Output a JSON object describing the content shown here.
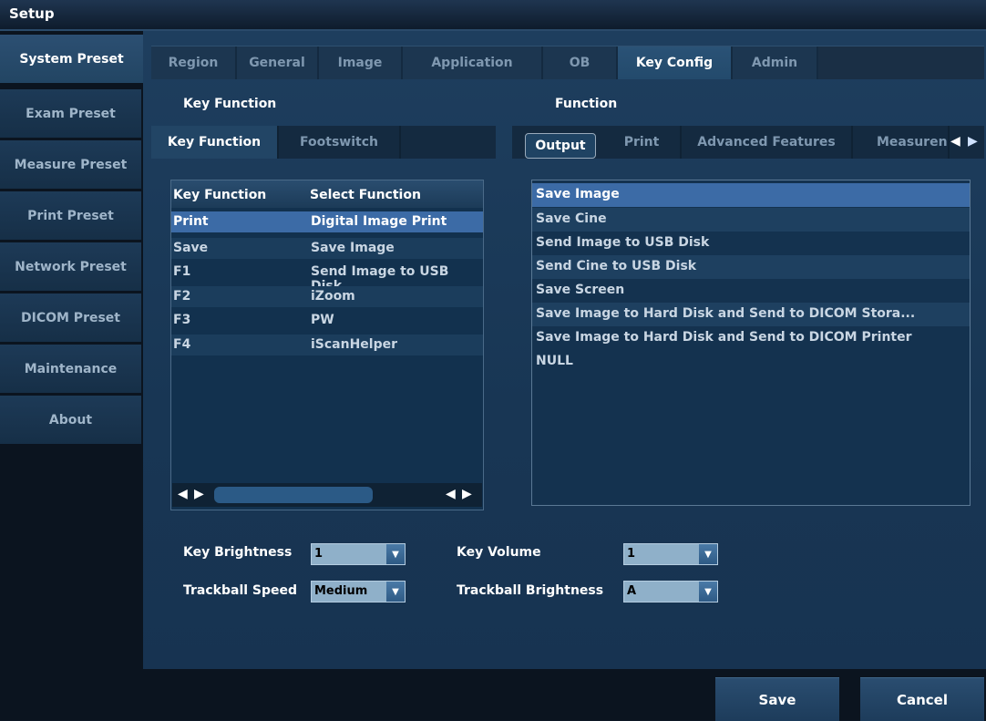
{
  "window": {
    "title": "Setup"
  },
  "sidebar": {
    "items": [
      {
        "label": "System Preset"
      },
      {
        "label": "Exam Preset"
      },
      {
        "label": "Measure Preset"
      },
      {
        "label": "Print Preset"
      },
      {
        "label": "Network Preset"
      },
      {
        "label": "DICOM Preset"
      },
      {
        "label": "Maintenance"
      },
      {
        "label": "About"
      }
    ]
  },
  "tabs": [
    {
      "label": "Region"
    },
    {
      "label": "General"
    },
    {
      "label": "Image"
    },
    {
      "label": "Application"
    },
    {
      "label": "OB"
    },
    {
      "label": "Key Config"
    },
    {
      "label": "Admin"
    }
  ],
  "key_function_section": {
    "title": "Key Function",
    "subtabs": [
      {
        "label": "Key Function"
      },
      {
        "label": "Footswitch"
      }
    ],
    "table": {
      "headers": [
        "Key Function",
        "Select Function"
      ],
      "rows": [
        {
          "key": "Print",
          "func": "Digital Image Print"
        },
        {
          "key": "Save",
          "func": "Save Image"
        },
        {
          "key": "F1",
          "func": "Send Image to USB Disk"
        },
        {
          "key": "F2",
          "func": "iZoom"
        },
        {
          "key": "F3",
          "func": "PW"
        },
        {
          "key": "F4",
          "func": "iScanHelper"
        }
      ]
    }
  },
  "function_section": {
    "title": "Function",
    "subtabs": [
      {
        "label": "Output"
      },
      {
        "label": "Print"
      },
      {
        "label": "Advanced Features"
      },
      {
        "label": "Measuren"
      }
    ],
    "list": [
      "Save Image",
      "Save Cine",
      "Send Image to USB Disk",
      "Send Cine to USB Disk",
      "Save Screen",
      "Save Image to Hard Disk and Send to DICOM Stora...",
      "Save Image to Hard Disk and Send to DICOM Printer",
      "NULL"
    ]
  },
  "controls": {
    "key_brightness": {
      "label": "Key Brightness",
      "value": "1"
    },
    "key_volume": {
      "label": "Key Volume",
      "value": "1"
    },
    "trackball_speed": {
      "label": "Trackball Speed",
      "value": "Medium"
    },
    "trackball_brightness": {
      "label": "Trackball Brightness",
      "value": "A"
    }
  },
  "footer": {
    "save_label": "Save",
    "cancel_label": "Cancel"
  }
}
